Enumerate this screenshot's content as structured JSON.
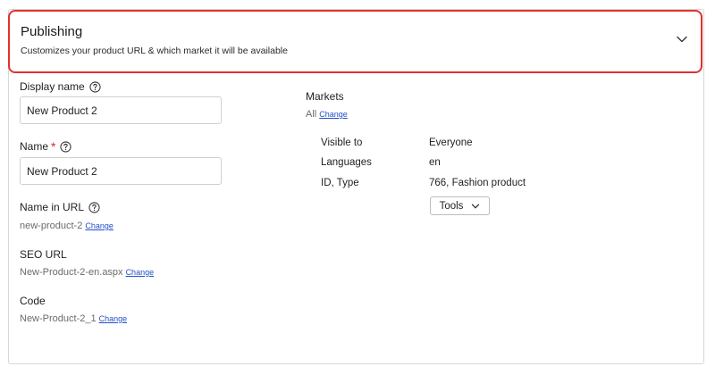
{
  "header": {
    "title": "Publishing",
    "subtitle": "Customizes your product URL & which market it will be available"
  },
  "form": {
    "display_name": {
      "label": "Display name",
      "value": "New Product 2"
    },
    "name": {
      "label": "Name",
      "required_mark": "*",
      "value": "New Product 2"
    },
    "name_in_url": {
      "label": "Name in URL",
      "value": "new-product-2",
      "change": "Change"
    },
    "seo_url": {
      "label": "SEO URL",
      "value": "New-Product-2-en.aspx",
      "change": "Change"
    },
    "code": {
      "label": "Code",
      "value": "New-Product-2_1",
      "change": "Change"
    }
  },
  "markets": {
    "label": "Markets",
    "value": "All",
    "change": "Change"
  },
  "info": {
    "rows": [
      {
        "key": "Visible to",
        "value": "Everyone"
      },
      {
        "key": "Languages",
        "value": "en"
      },
      {
        "key": "ID, Type",
        "value": "766, Fashion product"
      }
    ]
  },
  "tools": {
    "label": "Tools"
  },
  "colors": {
    "highlight_border": "#e0322f",
    "link": "#2450c9",
    "required": "#d62b27"
  },
  "icons": {
    "help": "question-circle-icon",
    "expand": "chevron-down-icon"
  }
}
